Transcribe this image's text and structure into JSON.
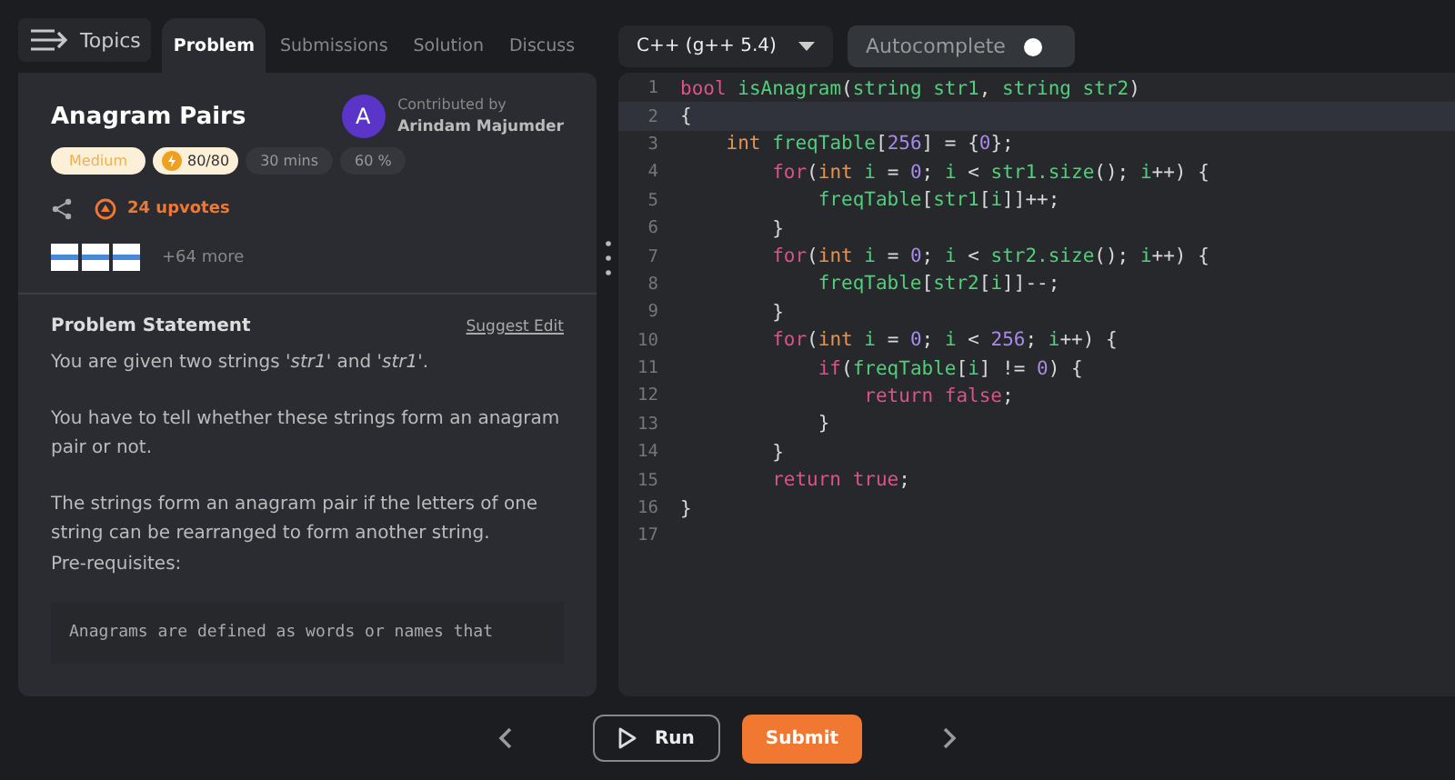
{
  "topics_button": {
    "label": "Topics"
  },
  "tabs": [
    {
      "label": "Problem",
      "selected": true
    },
    {
      "label": "Submissions",
      "selected": false
    },
    {
      "label": "Solution",
      "selected": false
    },
    {
      "label": "Discuss",
      "selected": false
    }
  ],
  "problem": {
    "title": "Anagram Pairs",
    "contributor_label": "Contributed by",
    "contributor": "Arindam Majumder",
    "avatar_letter": "A",
    "badges": [
      {
        "kind": "difficulty",
        "text": "Medium"
      },
      {
        "kind": "points",
        "text": "80/80"
      },
      {
        "kind": "plain",
        "text": "30 mins"
      },
      {
        "kind": "plain",
        "text": "60 %"
      }
    ],
    "upvotes": "24 upvotes",
    "companies_more": "+64 more",
    "statement_heading": "Problem Statement",
    "suggest_edit": "Suggest Edit",
    "paragraphs": [
      "You are given two strings *'str1'* and *'str1'*.",
      "You have to tell whether these strings form an anagram pair or not.",
      "The strings form an anagram pair if the letters of one string can be rearranged to form another string.\nPre-requisites:"
    ],
    "code_note": "Anagrams are defined as words or names that"
  },
  "editor": {
    "language": "C++ (g++ 5.4)",
    "autocomplete": {
      "label": "Autocomplete",
      "on": false
    },
    "lines": [
      {
        "number": "1",
        "current": false,
        "tokens": [
          {
            "kind": "keyword",
            "text": "bool"
          },
          {
            "kind": "ident",
            "text": " isAnagram"
          },
          {
            "kind": "punct",
            "text": "("
          },
          {
            "kind": "ident",
            "text": "string str1"
          },
          {
            "kind": "punct",
            "text": ", "
          },
          {
            "kind": "ident",
            "text": "string str2"
          },
          {
            "kind": "punct",
            "text": ")"
          }
        ]
      },
      {
        "number": "2",
        "current": true,
        "tokens": [
          {
            "kind": "punct",
            "text": "{"
          }
        ]
      },
      {
        "number": "3",
        "current": false,
        "tokens": [
          {
            "kind": "type",
            "text": "    int"
          },
          {
            "kind": "ident",
            "text": " freqTable"
          },
          {
            "kind": "punct",
            "text": "["
          },
          {
            "kind": "number",
            "text": "256"
          },
          {
            "kind": "punct",
            "text": "] = {"
          },
          {
            "kind": "number",
            "text": "0"
          },
          {
            "kind": "punct",
            "text": "};"
          }
        ]
      },
      {
        "number": "4",
        "current": false,
        "tokens": [
          {
            "kind": "keyword",
            "text": "        for"
          },
          {
            "kind": "punct",
            "text": "("
          },
          {
            "kind": "type",
            "text": "int"
          },
          {
            "kind": "ident",
            "text": " i"
          },
          {
            "kind": "punct",
            "text": " = "
          },
          {
            "kind": "number",
            "text": "0"
          },
          {
            "kind": "punct",
            "text": "; "
          },
          {
            "kind": "ident",
            "text": "i"
          },
          {
            "kind": "punct",
            "text": " < "
          },
          {
            "kind": "ident",
            "text": "str1.size"
          },
          {
            "kind": "punct",
            "text": "(); "
          },
          {
            "kind": "ident",
            "text": "i"
          },
          {
            "kind": "punct",
            "text": "++) {"
          }
        ]
      },
      {
        "number": "5",
        "current": false,
        "tokens": [
          {
            "kind": "ident",
            "text": "            freqTable"
          },
          {
            "kind": "punct",
            "text": "["
          },
          {
            "kind": "ident",
            "text": "str1"
          },
          {
            "kind": "punct",
            "text": "["
          },
          {
            "kind": "ident",
            "text": "i"
          },
          {
            "kind": "punct",
            "text": "]]++;"
          }
        ]
      },
      {
        "number": "6",
        "current": false,
        "tokens": [
          {
            "kind": "punct",
            "text": "        }"
          }
        ]
      },
      {
        "number": "7",
        "current": false,
        "tokens": [
          {
            "kind": "keyword",
            "text": "        for"
          },
          {
            "kind": "punct",
            "text": "("
          },
          {
            "kind": "type",
            "text": "int"
          },
          {
            "kind": "ident",
            "text": " i"
          },
          {
            "kind": "punct",
            "text": " = "
          },
          {
            "kind": "number",
            "text": "0"
          },
          {
            "kind": "punct",
            "text": "; "
          },
          {
            "kind": "ident",
            "text": "i"
          },
          {
            "kind": "punct",
            "text": " < "
          },
          {
            "kind": "ident",
            "text": "str2.size"
          },
          {
            "kind": "punct",
            "text": "(); "
          },
          {
            "kind": "ident",
            "text": "i"
          },
          {
            "kind": "punct",
            "text": "++) {"
          }
        ]
      },
      {
        "number": "8",
        "current": false,
        "tokens": [
          {
            "kind": "ident",
            "text": "            freqTable"
          },
          {
            "kind": "punct",
            "text": "["
          },
          {
            "kind": "ident",
            "text": "str2"
          },
          {
            "kind": "punct",
            "text": "["
          },
          {
            "kind": "ident",
            "text": "i"
          },
          {
            "kind": "punct",
            "text": "]]--;"
          }
        ]
      },
      {
        "number": "9",
        "current": false,
        "tokens": [
          {
            "kind": "punct",
            "text": "        }"
          }
        ]
      },
      {
        "number": "10",
        "current": false,
        "tokens": [
          {
            "kind": "keyword",
            "text": "        for"
          },
          {
            "kind": "punct",
            "text": "("
          },
          {
            "kind": "type",
            "text": "int"
          },
          {
            "kind": "ident",
            "text": " i"
          },
          {
            "kind": "punct",
            "text": " = "
          },
          {
            "kind": "number",
            "text": "0"
          },
          {
            "kind": "punct",
            "text": "; "
          },
          {
            "kind": "ident",
            "text": "i"
          },
          {
            "kind": "punct",
            "text": " < "
          },
          {
            "kind": "number",
            "text": "256"
          },
          {
            "kind": "punct",
            "text": "; "
          },
          {
            "kind": "ident",
            "text": "i"
          },
          {
            "kind": "punct",
            "text": "++) {"
          }
        ]
      },
      {
        "number": "11",
        "current": false,
        "tokens": [
          {
            "kind": "keyword",
            "text": "            if"
          },
          {
            "kind": "punct",
            "text": "("
          },
          {
            "kind": "ident",
            "text": "freqTable"
          },
          {
            "kind": "punct",
            "text": "["
          },
          {
            "kind": "ident",
            "text": "i"
          },
          {
            "kind": "punct",
            "text": "] != "
          },
          {
            "kind": "number",
            "text": "0"
          },
          {
            "kind": "punct",
            "text": ") {"
          }
        ]
      },
      {
        "number": "12",
        "current": false,
        "tokens": [
          {
            "kind": "keyword",
            "text": "                return false"
          },
          {
            "kind": "punct",
            "text": ";"
          }
        ]
      },
      {
        "number": "13",
        "current": false,
        "tokens": [
          {
            "kind": "punct",
            "text": "            }"
          }
        ]
      },
      {
        "number": "14",
        "current": false,
        "tokens": [
          {
            "kind": "punct",
            "text": "        }"
          }
        ]
      },
      {
        "number": "15",
        "current": false,
        "tokens": [
          {
            "kind": "keyword",
            "text": "        return true"
          },
          {
            "kind": "punct",
            "text": ";"
          }
        ]
      },
      {
        "number": "16",
        "current": false,
        "tokens": [
          {
            "kind": "punct",
            "text": "}"
          }
        ]
      },
      {
        "number": "17",
        "current": false
      }
    ]
  },
  "footer": {
    "run": "Run",
    "submit": "Submit"
  }
}
